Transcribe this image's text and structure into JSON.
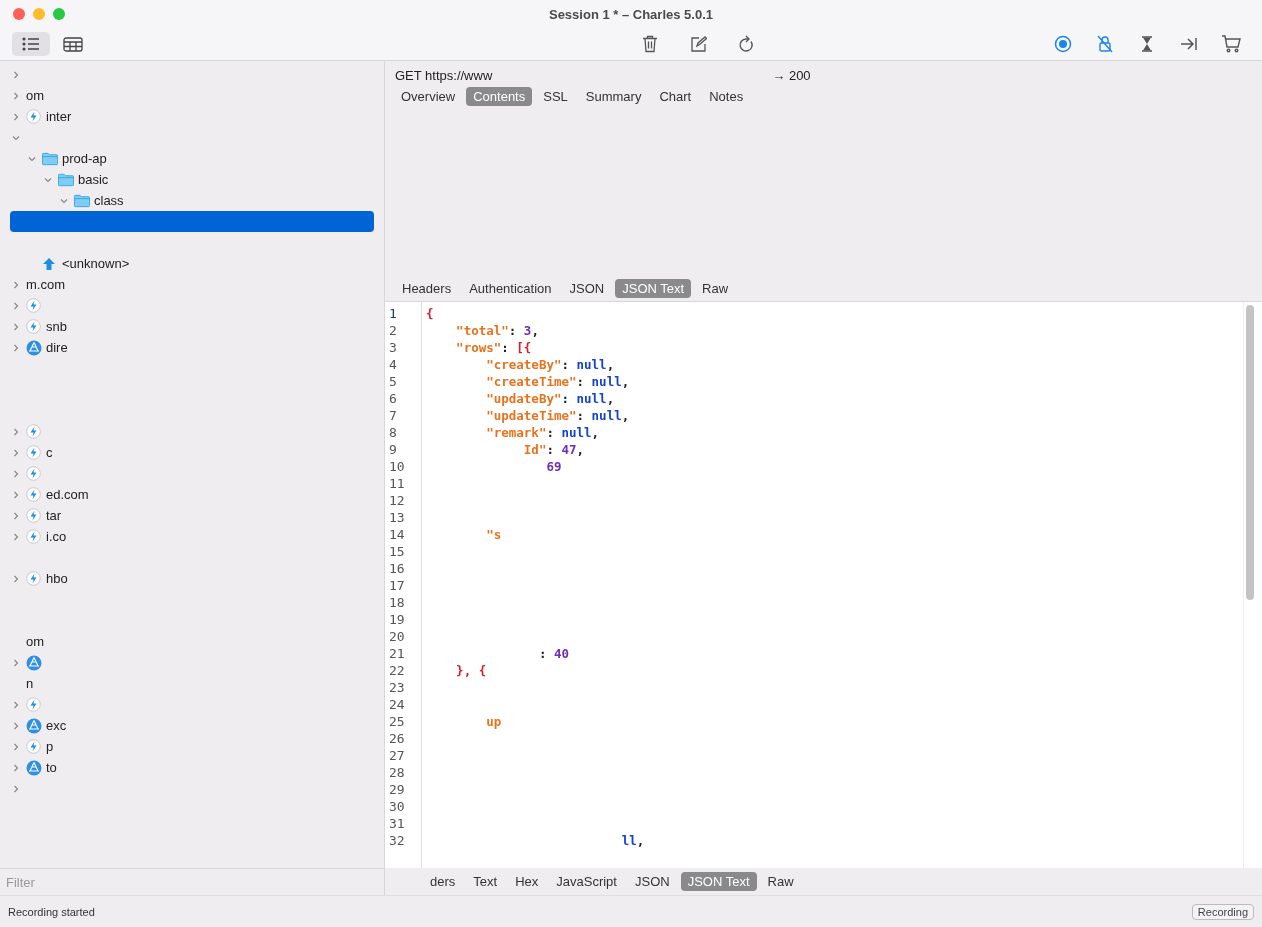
{
  "window": {
    "title": "Session 1 * – Charles 5.0.1"
  },
  "toolbar": {
    "view_buttons": [
      {
        "kind": "list",
        "selected": true
      },
      {
        "kind": "table",
        "selected": false
      }
    ],
    "actions": [
      {
        "kind": "trash"
      },
      {
        "kind": "edit"
      },
      {
        "kind": "refresh"
      }
    ],
    "toggles": [
      {
        "kind": "record",
        "on": true
      },
      {
        "kind": "lock",
        "on": true
      },
      {
        "kind": "hourglass",
        "on": false
      },
      {
        "kind": "step",
        "on": false
      },
      {
        "kind": "cart",
        "on": false
      }
    ]
  },
  "tree": [
    {
      "selected": false,
      "expanded": false
    },
    {
      "label": "om",
      "selected": false,
      "expanded": false
    },
    {
      "label": "inter",
      "kind": "bolt",
      "selected": false,
      "expanded": false
    },
    {
      "selected": false,
      "expanded": true,
      "children": [
        {
          "label": "prod-ap",
          "kind": "folder",
          "selected": false,
          "expanded": true,
          "children": [
            {
              "label": "basic",
              "kind": "folder",
              "selected": false,
              "expanded": true,
              "children": [
                {
                  "label": "class",
                  "kind": "folder",
                  "selected": false,
                  "expanded": true,
                  "children": [
                    {
                      "selected": true
                    },
                    {
                      "selected": false
                    }
                  ]
                }
              ]
            }
          ]
        },
        {
          "label": "<unknown>",
          "kind": "arrow",
          "selected": false
        }
      ]
    },
    {
      "label": "m.com",
      "selected": false,
      "expanded": false
    },
    {
      "kind": "bolt",
      "selected": false,
      "expanded": false
    },
    {
      "label": "snb",
      "kind": "bolt",
      "selected": false,
      "expanded": false
    },
    {
      "label": "dire",
      "kind": "globe",
      "selected": false,
      "expanded": false
    },
    {
      "selected": false
    },
    {
      "selected": false
    },
    {
      "selected": false
    },
    {
      "kind": "bolt",
      "selected": false,
      "expanded": false
    },
    {
      "label": "c",
      "kind": "bolt",
      "selected": false,
      "expanded": false
    },
    {
      "kind": "bolt",
      "selected": false,
      "expanded": false
    },
    {
      "label": "ed.com",
      "kind": "bolt",
      "selected": false,
      "expanded": false
    },
    {
      "label": "tar",
      "kind": "bolt",
      "selected": false,
      "expanded": false
    },
    {
      "label": "i.co",
      "kind": "bolt",
      "selected": false,
      "expanded": false
    },
    {
      "selected": false
    },
    {
      "label": "hbo",
      "kind": "bolt",
      "selected": false,
      "expanded": false
    },
    {
      "selected": false
    },
    {
      "selected": false
    },
    {
      "label": "om",
      "selected": false
    },
    {
      "kind": "globe",
      "selected": false,
      "expanded": false
    },
    {
      "label": "n",
      "selected": false
    },
    {
      "kind": "bolt",
      "selected": false,
      "expanded": false
    },
    {
      "label": "exc",
      "kind": "globe",
      "selected": false,
      "expanded": false
    },
    {
      "label": "p",
      "kind": "bolt",
      "selected": false,
      "expanded": false
    },
    {
      "label": "to",
      "kind": "globe",
      "selected": false,
      "expanded": false
    },
    {
      "selected": false,
      "expanded": false
    }
  ],
  "filter": {
    "placeholder": "Filter"
  },
  "request": {
    "method_url": "GET https://www",
    "result": "→ 200"
  },
  "tabs": [
    {
      "label": "Overview",
      "selected": false
    },
    {
      "label": "Contents",
      "selected": true
    },
    {
      "label": "SSL",
      "selected": false
    },
    {
      "label": "Summary",
      "selected": false
    },
    {
      "label": "Chart",
      "selected": false
    },
    {
      "label": "Notes",
      "selected": false
    }
  ],
  "response_tabs": [
    {
      "label": "Headers",
      "selected": false
    },
    {
      "label": "Authentication",
      "selected": false
    },
    {
      "label": "JSON",
      "selected": false
    },
    {
      "label": "JSON Text",
      "selected": true
    },
    {
      "label": "Raw",
      "selected": false
    }
  ],
  "code": [
    {
      "number": "1",
      "tokens": [
        {
          "kind": "punct",
          "text": "{"
        }
      ]
    },
    {
      "number": "2",
      "tokens": [
        {
          "kind": "key",
          "text": "    \"total\""
        },
        {
          "kind": "plain",
          "text": ": "
        },
        {
          "kind": "number",
          "text": "3"
        },
        {
          "kind": "plain",
          "text": ","
        }
      ]
    },
    {
      "number": "3",
      "tokens": [
        {
          "kind": "key",
          "text": "    \"rows\""
        },
        {
          "kind": "plain",
          "text": ": "
        },
        {
          "kind": "punct",
          "text": "[{"
        }
      ]
    },
    {
      "number": "4",
      "tokens": [
        {
          "kind": "key",
          "text": "        \"createBy\""
        },
        {
          "kind": "plain",
          "text": ": "
        },
        {
          "kind": "null",
          "text": "null"
        },
        {
          "kind": "plain",
          "text": ","
        }
      ]
    },
    {
      "number": "5",
      "tokens": [
        {
          "kind": "key",
          "text": "        \"createTime\""
        },
        {
          "kind": "plain",
          "text": ": "
        },
        {
          "kind": "null",
          "text": "null"
        },
        {
          "kind": "plain",
          "text": ","
        }
      ]
    },
    {
      "number": "6",
      "tokens": [
        {
          "kind": "key",
          "text": "        \"updateBy\""
        },
        {
          "kind": "plain",
          "text": ": "
        },
        {
          "kind": "null",
          "text": "null"
        },
        {
          "kind": "plain",
          "text": ","
        }
      ]
    },
    {
      "number": "7",
      "tokens": [
        {
          "kind": "key",
          "text": "        \"updateTime\""
        },
        {
          "kind": "plain",
          "text": ": "
        },
        {
          "kind": "null",
          "text": "null"
        },
        {
          "kind": "plain",
          "text": ","
        }
      ]
    },
    {
      "number": "8",
      "tokens": [
        {
          "kind": "key",
          "text": "        \"remark\""
        },
        {
          "kind": "plain",
          "text": ": "
        },
        {
          "kind": "null",
          "text": "null"
        },
        {
          "kind": "plain",
          "text": ","
        }
      ]
    },
    {
      "number": "9",
      "tokens": [
        {
          "kind": "key",
          "text": "             Id\""
        },
        {
          "kind": "plain",
          "text": ": "
        },
        {
          "kind": "number",
          "text": "47"
        },
        {
          "kind": "plain",
          "text": ","
        }
      ]
    },
    {
      "number": "10",
      "tokens": [
        {
          "kind": "number",
          "text": "                69"
        }
      ]
    },
    {
      "number": "11"
    },
    {
      "number": "12"
    },
    {
      "number": "13"
    },
    {
      "number": "14",
      "tokens": [
        {
          "kind": "key",
          "text": "        \"s"
        }
      ]
    },
    {
      "number": "15"
    },
    {
      "number": "16"
    },
    {
      "number": "17"
    },
    {
      "number": "18"
    },
    {
      "number": "19"
    },
    {
      "number": "20"
    },
    {
      "number": "21",
      "tokens": [
        {
          "kind": "plain",
          "text": "               : "
        },
        {
          "kind": "number",
          "text": "40"
        }
      ]
    },
    {
      "number": "22",
      "tokens": [
        {
          "kind": "punct",
          "text": "    }, {"
        }
      ]
    },
    {
      "number": "23"
    },
    {
      "number": "24"
    },
    {
      "number": "25",
      "tokens": [
        {
          "kind": "key",
          "text": "        up"
        }
      ]
    },
    {
      "number": "26"
    },
    {
      "number": "27"
    },
    {
      "number": "28"
    },
    {
      "number": "29"
    },
    {
      "number": "30"
    },
    {
      "number": "31"
    },
    {
      "number": "32",
      "tokens": [
        {
          "kind": "null",
          "text": "                          ll"
        },
        {
          "kind": "plain",
          "text": ","
        }
      ]
    }
  ],
  "view_tabs": [
    {
      "label": "ders",
      "selected": false
    },
    {
      "label": "Text",
      "selected": false
    },
    {
      "label": "Hex",
      "selected": false
    },
    {
      "label": "JavaScript",
      "selected": false
    },
    {
      "label": "JSON",
      "selected": false
    },
    {
      "label": "JSON Text",
      "selected": true
    },
    {
      "label": "Raw",
      "selected": false
    }
  ],
  "status_bar": {
    "message": "Recording started",
    "button": "Recording"
  }
}
